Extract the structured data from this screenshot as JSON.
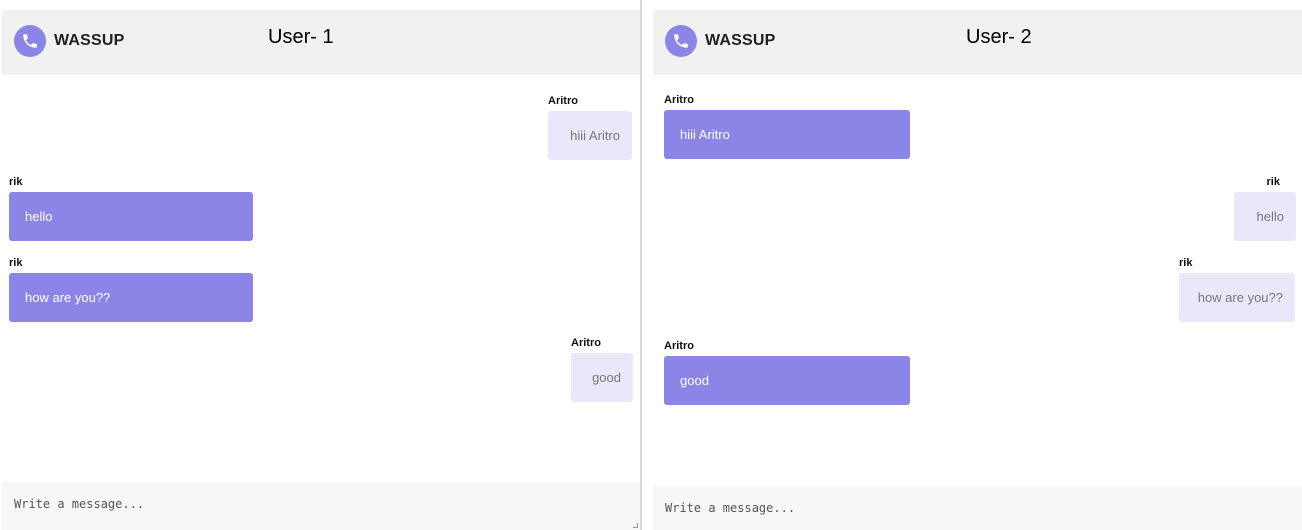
{
  "left": {
    "app_name": "WASSUP",
    "user_tag": "User- 1",
    "messages": [
      {
        "sender": "Aritro",
        "text": "hiii Aritro"
      },
      {
        "sender": "rik",
        "text": "hello"
      },
      {
        "sender": "rik",
        "text": "how are you??"
      },
      {
        "sender": "Aritro",
        "text": "good"
      }
    ],
    "composer_placeholder": "Write a message..."
  },
  "right": {
    "app_name": "WASSUP",
    "user_tag": "User- 2",
    "messages": [
      {
        "sender": "Aritro",
        "text": "hiii Aritro"
      },
      {
        "sender": "rik",
        "text": "hello"
      },
      {
        "sender": "rik",
        "text": "how are you??"
      },
      {
        "sender": "Aritro",
        "text": "good"
      }
    ],
    "composer_placeholder": "Write a message..."
  },
  "colors": {
    "accent": "#8b85e8",
    "received_bubble": "#e8e8fa",
    "header_bg": "#f1f1f1"
  },
  "icons": {
    "logo": "phone-icon"
  }
}
